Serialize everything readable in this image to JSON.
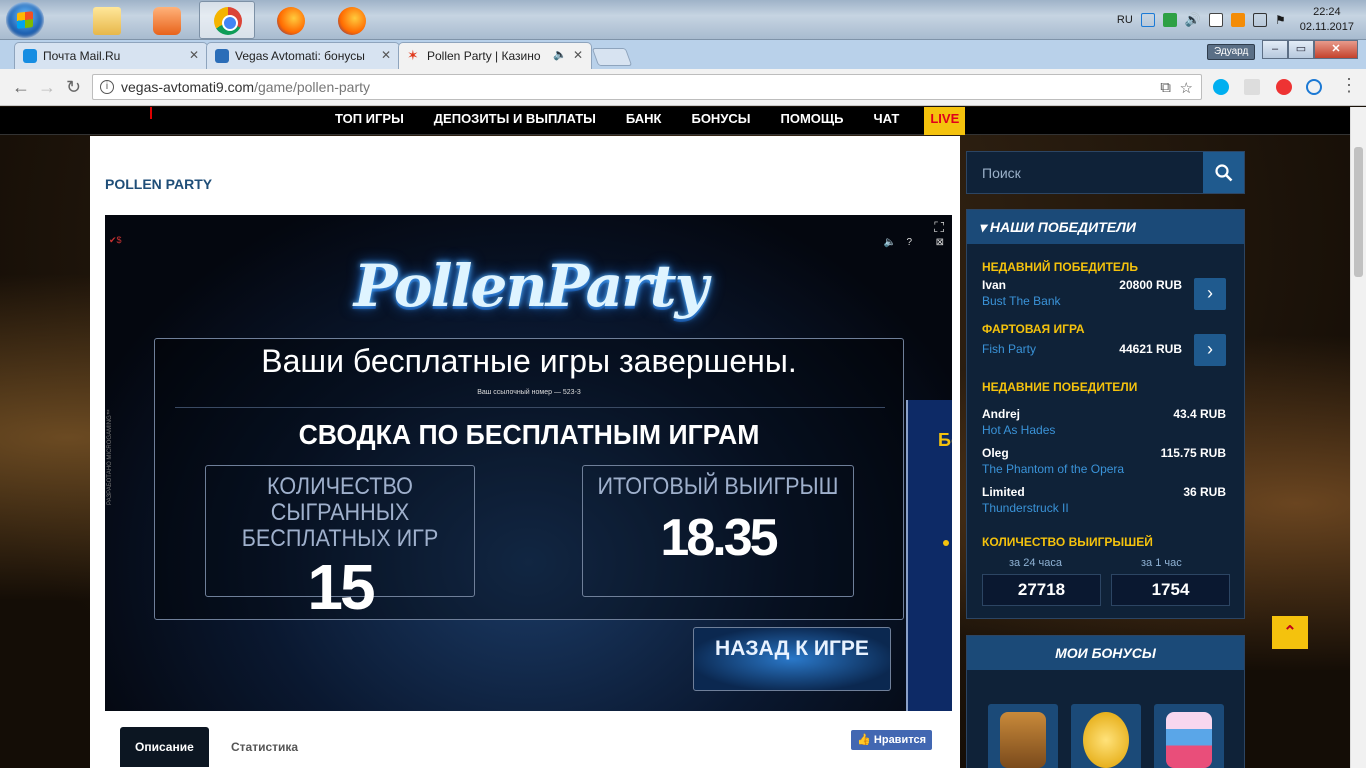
{
  "taskbar": {
    "apps": [
      "explorer",
      "media-player",
      "chrome",
      "firefox",
      "firefox"
    ],
    "lang": "RU",
    "time": "22:24",
    "date": "02.11.2017"
  },
  "browser": {
    "tabs": [
      {
        "title": "Почта Mail.Ru",
        "favicon_color": "#168de2"
      },
      {
        "title": "Vegas Avtomati: бонусы",
        "favicon_color": "#2a6db8"
      },
      {
        "title": "Pollen Party | Казино",
        "favicon_color": "#e0381b"
      }
    ],
    "user_badge": "Эдуард",
    "url_host": "vegas-avtomati9.com",
    "url_path": "/game/pollen-party"
  },
  "site": {
    "nav": [
      "ТОП ИГРЫ",
      "ДЕПОЗИТЫ И ВЫПЛАТЫ",
      "БАНК",
      "БОНУСЫ",
      "ПОМОЩЬ",
      "ЧАТ",
      "LIVE"
    ],
    "game_title": "POLLEN PARTY",
    "game": {
      "logo": "PollenParty",
      "headline": "Ваши  бесплатные игры завершены.",
      "ref": "Ваш ссылочный номер — 523-3",
      "summary_title": "СВОДКА ПО БЕСПЛАТНЫМ ИГРАМ",
      "played_label": "КОЛИЧЕСТВО СЫГРАННЫХ БЕСПЛАТНЫХ ИГР",
      "played_value": "15",
      "win_label": "ИТОГОВЫЙ ВЫИГРЫШ",
      "win_value": "18.35",
      "back_button": "НАЗАД К ИГРЕ",
      "side_letter": "Бо",
      "vertical_text": "РАЗРАБОТАНО MICROGAMING™"
    },
    "content_tabs": {
      "description": "Описание",
      "stats": "Статистика",
      "like": "Нравится"
    },
    "sidebar": {
      "search_placeholder": "Поиск",
      "winners_title": "НАШИ ПОБЕДИТЕЛИ",
      "recent_winner_title": "НЕДАВНИЙ ПОБЕДИТЕЛЬ",
      "recent_winner": {
        "name": "Ivan",
        "game": "Bust The Bank",
        "amount": "20800 RUB"
      },
      "lucky_game_title": "ФАРТОВАЯ ИГРА",
      "lucky_game": {
        "game": "Fish Party",
        "amount": "44621 RUB"
      },
      "recent_winners_title": "НЕДАВНИЕ ПОБЕДИТЕЛИ",
      "recent_winners": [
        {
          "name": "Andrej",
          "game": "Hot As Hades",
          "amount": "43.4 RUB"
        },
        {
          "name": "Oleg",
          "game": "The Phantom of the Opera",
          "amount": "115.75 RUB"
        },
        {
          "name": "Limited",
          "game": "Thunderstruck II",
          "amount": "36 RUB"
        }
      ],
      "count_title": "КОЛИЧЕСТВО ВЫИГРЫШЕЙ",
      "count_24h_label": "за 24 часа",
      "count_1h_label": "за 1 час",
      "count_24h": "27718",
      "count_1h": "1754",
      "bonuses_title": "МОИ БОНУСЫ"
    }
  }
}
